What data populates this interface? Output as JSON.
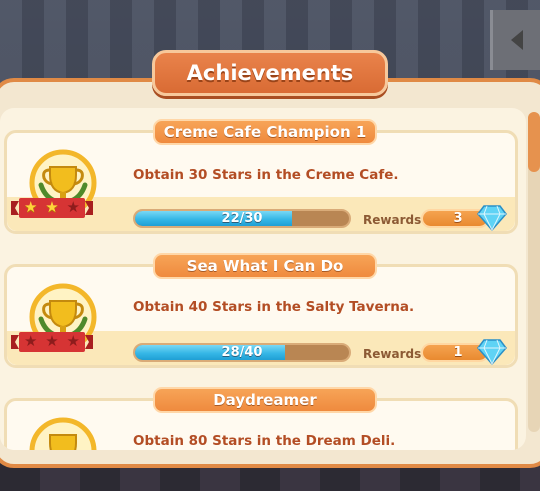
{
  "title": "Achievements",
  "rewards_label": "Rewards",
  "colors": {
    "accent": "#e08a45",
    "progress": "#36b7e6",
    "text": "#b34d24"
  },
  "achievements": [
    {
      "name": "Creme Cafe Champion 1",
      "description": "Obtain 30 Stars in the Creme Cafe.",
      "progress_text": "22/30",
      "progress_fraction": 0.733,
      "stars_earned": 2,
      "reward": "3",
      "reward_icon": "diamond-gem-icon"
    },
    {
      "name": "Sea What I Can Do",
      "description": "Obtain 40 Stars in the Salty Taverna.",
      "progress_text": "28/40",
      "progress_fraction": 0.7,
      "stars_earned": 0,
      "reward": "1",
      "reward_icon": "diamond-gem-icon"
    },
    {
      "name": "Daydreamer",
      "description": "Obtain 80 Stars in the Dream Deli.",
      "stars_earned": 0
    }
  ]
}
